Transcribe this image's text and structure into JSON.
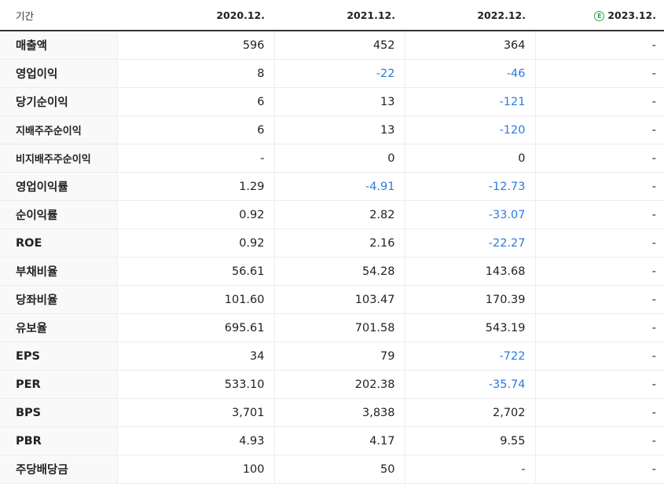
{
  "header": {
    "period_label": "기간",
    "estimate_mark": "E",
    "columns": [
      "2020.12.",
      "2021.12.",
      "2022.12.",
      "2023.12."
    ]
  },
  "rows": [
    {
      "label": "매출액",
      "values": [
        "596",
        "452",
        "364",
        "-"
      ]
    },
    {
      "label": "영업이익",
      "values": [
        "8",
        "-22",
        "-46",
        "-"
      ]
    },
    {
      "label": "당기순이익",
      "values": [
        "6",
        "13",
        "-121",
        "-"
      ]
    },
    {
      "label": "지배주주순이익",
      "values": [
        "6",
        "13",
        "-120",
        "-"
      ]
    },
    {
      "label": "비지배주주순이익",
      "values": [
        "-",
        "0",
        "0",
        "-"
      ]
    },
    {
      "label": "영업이익률",
      "values": [
        "1.29",
        "-4.91",
        "-12.73",
        "-"
      ]
    },
    {
      "label": "순이익률",
      "values": [
        "0.92",
        "2.82",
        "-33.07",
        "-"
      ]
    },
    {
      "label": "ROE",
      "values": [
        "0.92",
        "2.16",
        "-22.27",
        "-"
      ]
    },
    {
      "label": "부채비율",
      "values": [
        "56.61",
        "54.28",
        "143.68",
        "-"
      ]
    },
    {
      "label": "당좌비율",
      "values": [
        "101.60",
        "103.47",
        "170.39",
        "-"
      ]
    },
    {
      "label": "유보율",
      "values": [
        "695.61",
        "701.58",
        "543.19",
        "-"
      ]
    },
    {
      "label": "EPS",
      "values": [
        "34",
        "79",
        "-722",
        "-"
      ]
    },
    {
      "label": "PER",
      "values": [
        "533.10",
        "202.38",
        "-35.74",
        "-"
      ]
    },
    {
      "label": "BPS",
      "values": [
        "3,701",
        "3,838",
        "2,702",
        "-"
      ]
    },
    {
      "label": "PBR",
      "values": [
        "4.93",
        "4.17",
        "9.55",
        "-"
      ]
    },
    {
      "label": "주당배당금",
      "values": [
        "100",
        "50",
        "-",
        "-"
      ]
    }
  ],
  "colors": {
    "negative": "#2c7be0",
    "estimate_badge": "#2ba84a"
  }
}
